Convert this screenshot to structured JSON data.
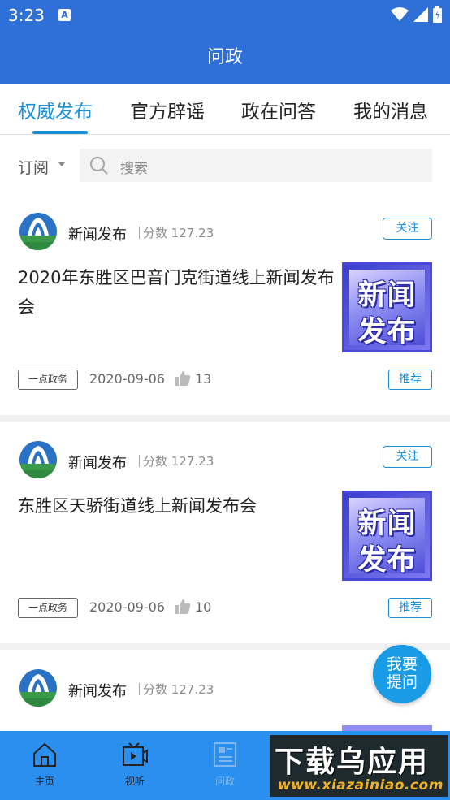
{
  "status_bar": {
    "time": "3:23",
    "notif_letter": "A"
  },
  "header": {
    "title": "问政"
  },
  "tabs": [
    {
      "label": "权威发布",
      "active": true
    },
    {
      "label": "官方辟谣",
      "active": false
    },
    {
      "label": "政在问答",
      "active": false
    },
    {
      "label": "我的消息",
      "active": false
    }
  ],
  "filter": {
    "subscribe_label": "订阅",
    "search_placeholder": "搜索"
  },
  "cards": [
    {
      "source": "新闻发布",
      "score": "分数 127.23",
      "follow_label": "关注",
      "title": "2020年东胜区巴音门克街道线上新闻发布会",
      "thumb_line1": "新闻",
      "thumb_line2": "发布",
      "tag": "一点政务",
      "date": "2020-09-06",
      "likes": "13",
      "recommend_label": "推荐"
    },
    {
      "source": "新闻发布",
      "score": "分数 127.23",
      "follow_label": "关注",
      "title": "东胜区天骄街道线上新闻发布会",
      "thumb_line1": "新闻",
      "thumb_line2": "发布",
      "tag": "一点政务",
      "date": "2020-09-06",
      "likes": "10",
      "recommend_label": "推荐"
    },
    {
      "source": "新闻发布",
      "score": "分数 127.23"
    }
  ],
  "fab": {
    "line1": "我要",
    "line2": "提问"
  },
  "bottom_nav": [
    {
      "label": "主页",
      "icon": "home-icon"
    },
    {
      "label": "视听",
      "icon": "tv-icon"
    },
    {
      "label": "问政",
      "icon": "document-icon"
    }
  ],
  "watermark": {
    "big": "下载乌应用",
    "small": "www.xiazainiao.com"
  },
  "colors": {
    "primary": "#2f6fd8",
    "accent": "#1a8fd6",
    "nav": "#2b8ff0"
  }
}
